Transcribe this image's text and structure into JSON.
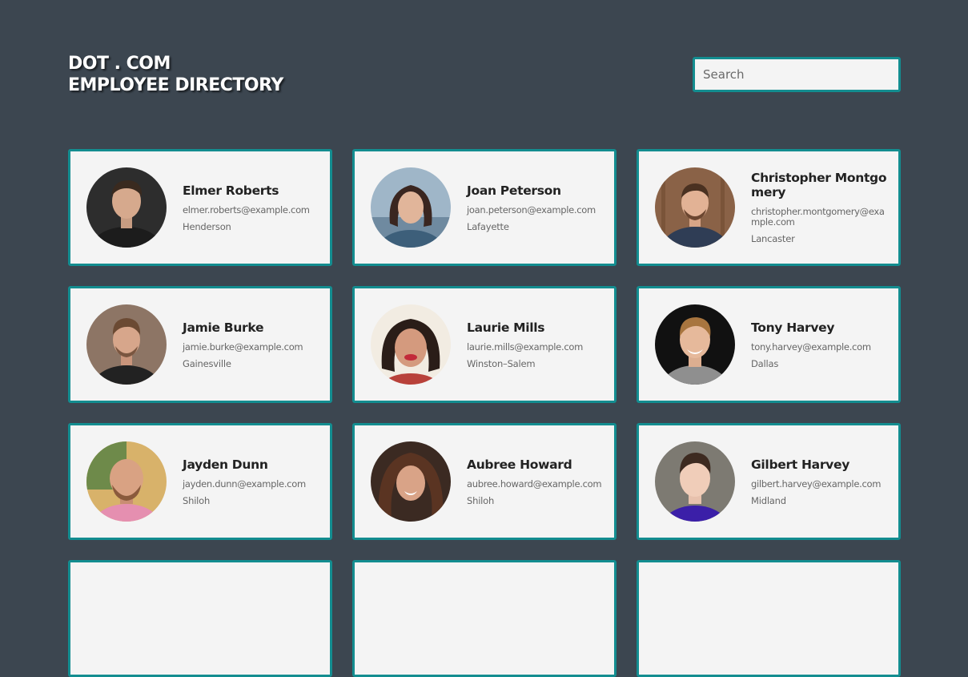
{
  "header": {
    "line1": "DOT . COM",
    "line2": "EMPLOYEE DIRECTORY"
  },
  "search": {
    "placeholder": "Search",
    "value": ""
  },
  "colors": {
    "background": "#3c4650",
    "card": "#f4f4f4",
    "accent": "#138d90"
  },
  "employees": [
    {
      "name": "Elmer Roberts",
      "email": "elmer.roberts@example.com",
      "city": "Henderson"
    },
    {
      "name": "Joan Peterson",
      "email": "joan.peterson@example.com",
      "city": "Lafayette"
    },
    {
      "name": "Christopher Montgomery",
      "email": "christopher.montgomery@example.com",
      "city": "Lancaster"
    },
    {
      "name": "Jamie Burke",
      "email": "jamie.burke@example.com",
      "city": "Gainesville"
    },
    {
      "name": "Laurie Mills",
      "email": "laurie.mills@example.com",
      "city": "Winston–Salem"
    },
    {
      "name": "Tony Harvey",
      "email": "tony.harvey@example.com",
      "city": "Dallas"
    },
    {
      "name": "Jayden Dunn",
      "email": "jayden.dunn@example.com",
      "city": "Shiloh"
    },
    {
      "name": "Aubree Howard",
      "email": "aubree.howard@example.com",
      "city": "Shiloh"
    },
    {
      "name": "Gilbert Harvey",
      "email": "gilbert.harvey@example.com",
      "city": "Midland"
    }
  ]
}
